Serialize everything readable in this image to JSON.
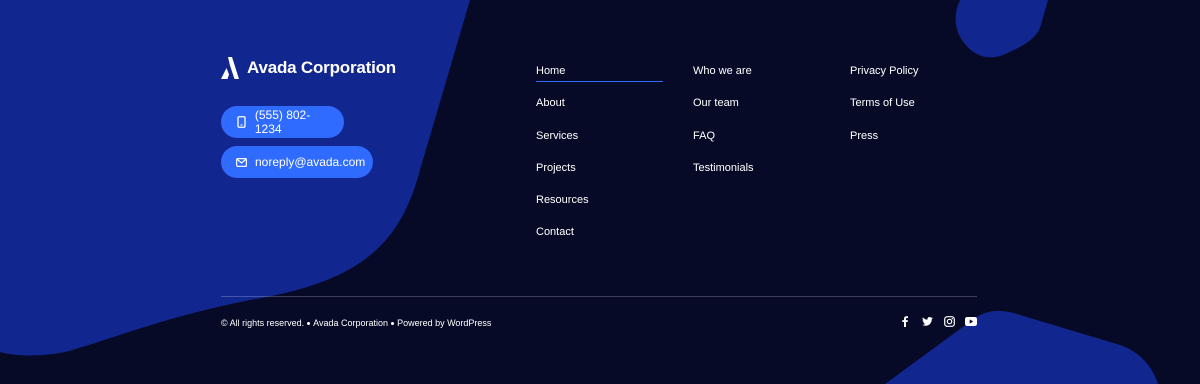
{
  "brand": {
    "name": "Avada Corporation",
    "logo_icon": "avada-logo-icon"
  },
  "contact": {
    "phone": {
      "label": "(555) 802-1234",
      "icon": "phone-icon"
    },
    "email": {
      "label": "noreply@avada.com",
      "icon": "mail-icon"
    }
  },
  "nav": {
    "column_1": [
      {
        "label": "Home",
        "active": true
      },
      {
        "label": "About"
      },
      {
        "label": "Services"
      },
      {
        "label": "Projects"
      },
      {
        "label": "Resources"
      },
      {
        "label": "Contact"
      }
    ],
    "column_2": [
      {
        "label": "Who we are"
      },
      {
        "label": "Our team"
      },
      {
        "label": "FAQ"
      },
      {
        "label": "Testimonials"
      }
    ],
    "column_3": [
      {
        "label": "Privacy Policy"
      },
      {
        "label": "Terms of Use"
      },
      {
        "label": "Press"
      }
    ]
  },
  "footer_bottom": {
    "copyright": "© All rights reserved.",
    "company": "Avada Corporation",
    "powered": "Powered by WordPress"
  },
  "social": [
    {
      "name": "facebook-icon"
    },
    {
      "name": "twitter-icon"
    },
    {
      "name": "instagram-icon"
    },
    {
      "name": "youtube-icon"
    }
  ],
  "colors": {
    "background": "#060a26",
    "shape": "#12268f",
    "accent": "#2f6bff",
    "text": "#ffffff"
  }
}
